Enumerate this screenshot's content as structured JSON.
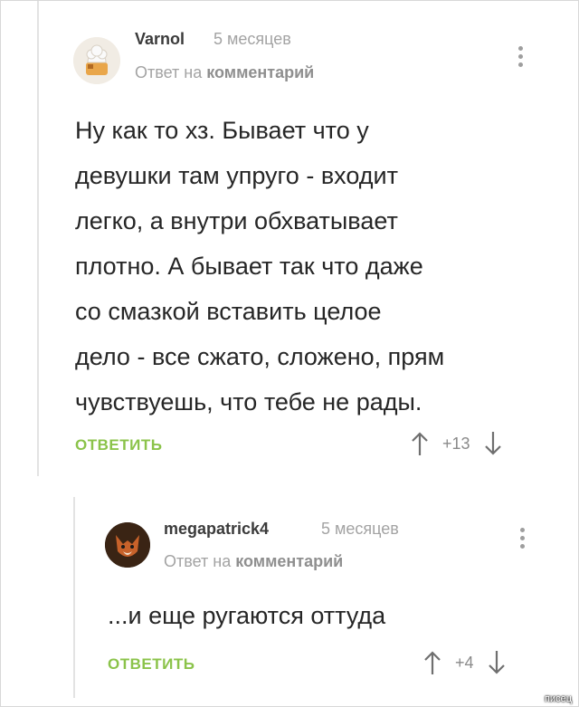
{
  "comment1": {
    "username": "Varnol",
    "time": "5 месяцев",
    "reply_prefix": "Ответ на",
    "reply_target": "комментарий",
    "text": "Ну как то хз. Бывает что у\nдевушки там упруго - входит\nлегко, а внутри обхватывает\nплотно. А бывает так что даже\nсо смазкой вставить целое\nдело - все сжато, сложено, прям\nчувствуешь, что тебе не рады.",
    "reply_button": "ОТВЕТИТЬ",
    "score": "+13"
  },
  "comment2": {
    "username": "megapatrick4",
    "time": "5 месяцев",
    "reply_prefix": "Ответ на",
    "reply_target": "комментарий",
    "text": "...и еще ругаются оттуда",
    "reply_button": "ОТВЕТИТЬ",
    "score": "+4"
  },
  "watermark": "пиcец",
  "colors": {
    "accent": "#8bc34a",
    "muted": "#a3a3a3",
    "text": "#262626"
  }
}
